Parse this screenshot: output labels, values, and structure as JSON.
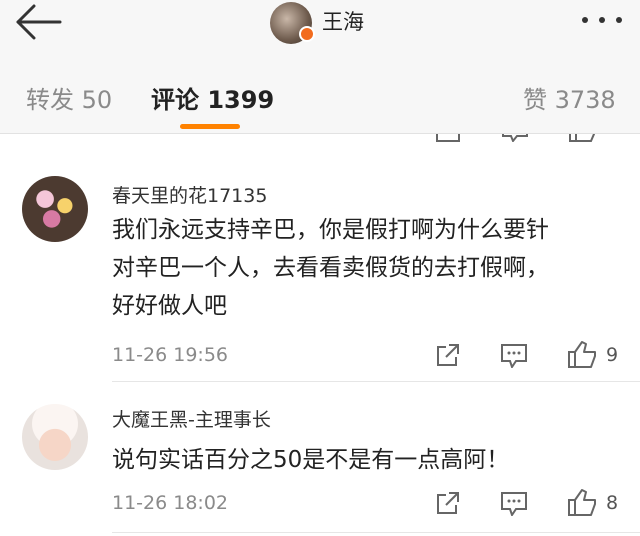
{
  "header": {
    "title": "王海"
  },
  "tabs": [
    {
      "label": "转发 50"
    },
    {
      "label": "评论 1399"
    },
    {
      "label": "赞 3738"
    }
  ],
  "comments": [
    {
      "username": "春天里的花17135",
      "lines": [
        "我们永远支持辛巴，你是假打啊为什么要针",
        "对辛巴一个人，去看看卖假货的去打假啊，",
        "好好做人吧"
      ],
      "time": "11-26 19:56",
      "likes": "9"
    },
    {
      "username": "大魔王黑-主理事长",
      "lines": [
        "说句实话百分之50是不是有一点高阿！"
      ],
      "time": "11-26 18:02",
      "likes": "8"
    }
  ],
  "colors": {
    "accent": "#ff8200",
    "badge": "#f26c1e"
  }
}
